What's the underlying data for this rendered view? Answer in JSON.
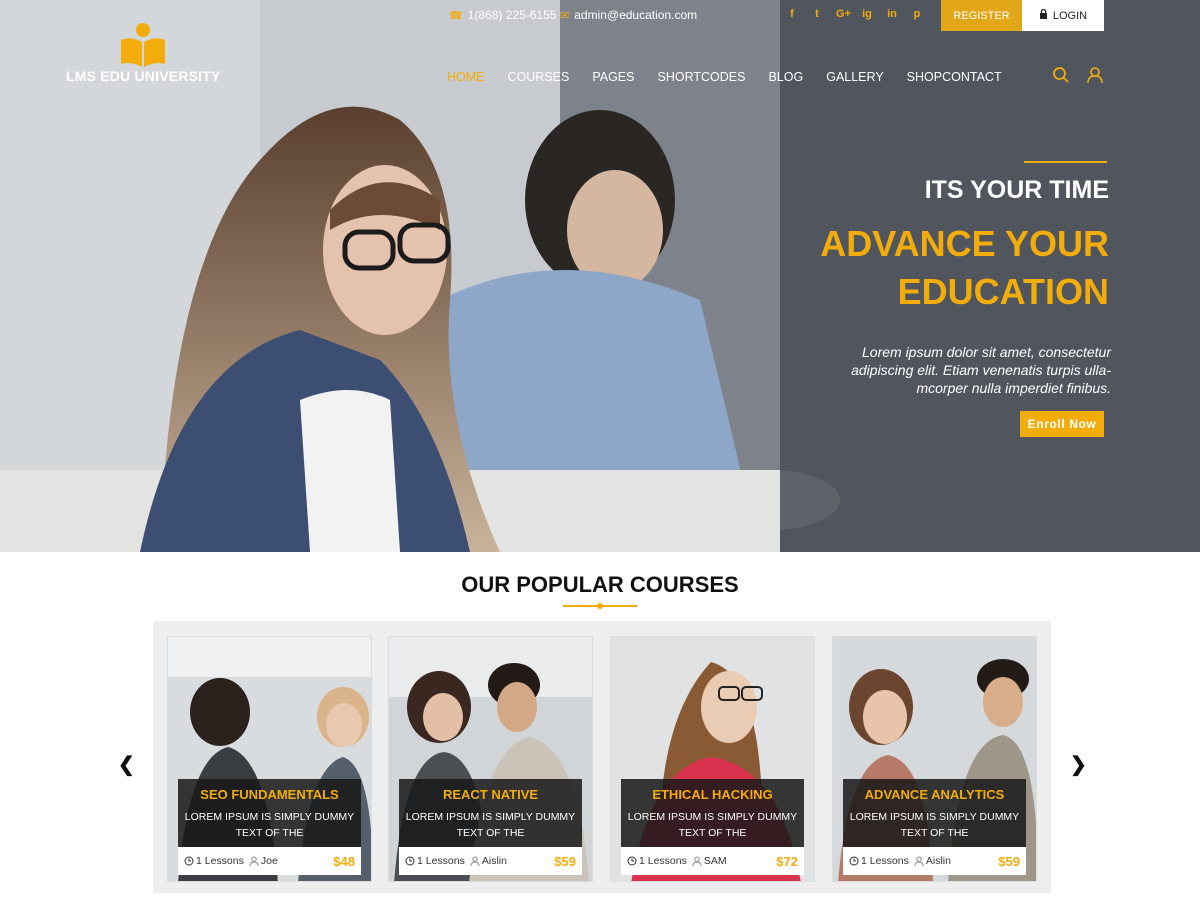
{
  "brand": {
    "name": "LMS EDU UNIVERSITY",
    "accent": "#f3ad0b"
  },
  "topbar": {
    "phone": "1(868) 225-6155",
    "email": "admin@education.com",
    "social": [
      "f",
      "t",
      "G+",
      "ig",
      "in",
      "p"
    ],
    "register_label": "REGISTER",
    "login_label": "LOGIN"
  },
  "nav": {
    "items": [
      {
        "label": "HOME",
        "active": true
      },
      {
        "label": "COURSES"
      },
      {
        "label": "PAGES"
      },
      {
        "label": "SHORTCODES"
      },
      {
        "label": "BLOG"
      },
      {
        "label": "GALLERY"
      },
      {
        "label": "SHOPCONTACT"
      }
    ],
    "icons": [
      "search-icon",
      "user-icon"
    ]
  },
  "hero": {
    "kicker": "ITS YOUR TIME",
    "title_line1": "ADVANCE YOUR",
    "title_line2": "EDUCATION",
    "description": "Lorem ipsum dolor sit amet, consectetur adipiscing elit. Etiam venenatis turpis ulla- mcorper nulla imperdiet finibus.",
    "cta_label": "Enroll Now"
  },
  "courses": {
    "section_title": "OUR POPULAR COURSES",
    "items": [
      {
        "title": "SEO FUNDAMENTALS",
        "description": "LOREM IPSUM IS SIMPLY DUMMY TEXT OF THE",
        "lessons": "1 Lessons",
        "author": "Joe",
        "price": "$48"
      },
      {
        "title": "REACT NATIVE",
        "description": "LOREM IPSUM IS SIMPLY DUMMY TEXT OF THE",
        "lessons": "1 Lessons",
        "author": "Aislin",
        "price": "$59"
      },
      {
        "title": "ETHICAL HACKING",
        "description": "LOREM IPSUM IS SIMPLY DUMMY TEXT OF THE",
        "lessons": "1 Lessons",
        "author": "SAM",
        "price": "$72"
      },
      {
        "title": "ADVANCE ANALYTICS",
        "description": "LOREM IPSUM IS SIMPLY DUMMY TEXT OF THE",
        "lessons": "1 Lessons",
        "author": "Aislin",
        "price": "$59"
      }
    ],
    "prev_icon": "chevron-left-icon",
    "next_icon": "chevron-right-icon"
  }
}
